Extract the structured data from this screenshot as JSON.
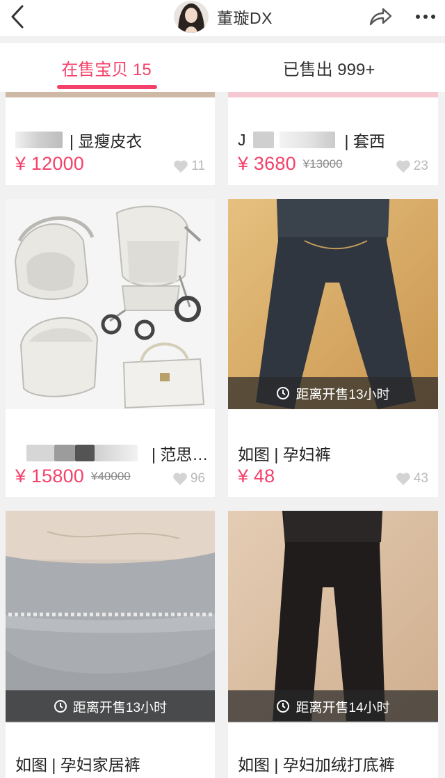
{
  "header": {
    "username": "董璇DX"
  },
  "tabs": [
    {
      "label": "在售宝贝 15"
    },
    {
      "label": "已售出 999+"
    }
  ],
  "products": [
    {
      "title": "| 显瘦皮衣",
      "price": "¥ 12000",
      "old_price": "",
      "likes": "11"
    },
    {
      "title": "| 套西",
      "title_prefix": "J",
      "price": "¥ 3680",
      "old_price": "¥13000",
      "likes": "23"
    },
    {
      "title": "| 范思…",
      "price": "¥ 15800",
      "old_price": "¥40000",
      "likes": "96"
    },
    {
      "title": "如图 | 孕妇裤",
      "price": "¥ 48",
      "old_price": "",
      "likes": "43",
      "countdown": "距离开售13小时"
    },
    {
      "title": "如图 | 孕妇家居裤",
      "countdown": "距离开售13小时"
    },
    {
      "title": "如图 | 孕妇加绒打底裤",
      "countdown": "距离开售14小时"
    }
  ],
  "colors": {
    "accent": "#f4416a",
    "background": "#f1f1f1"
  }
}
